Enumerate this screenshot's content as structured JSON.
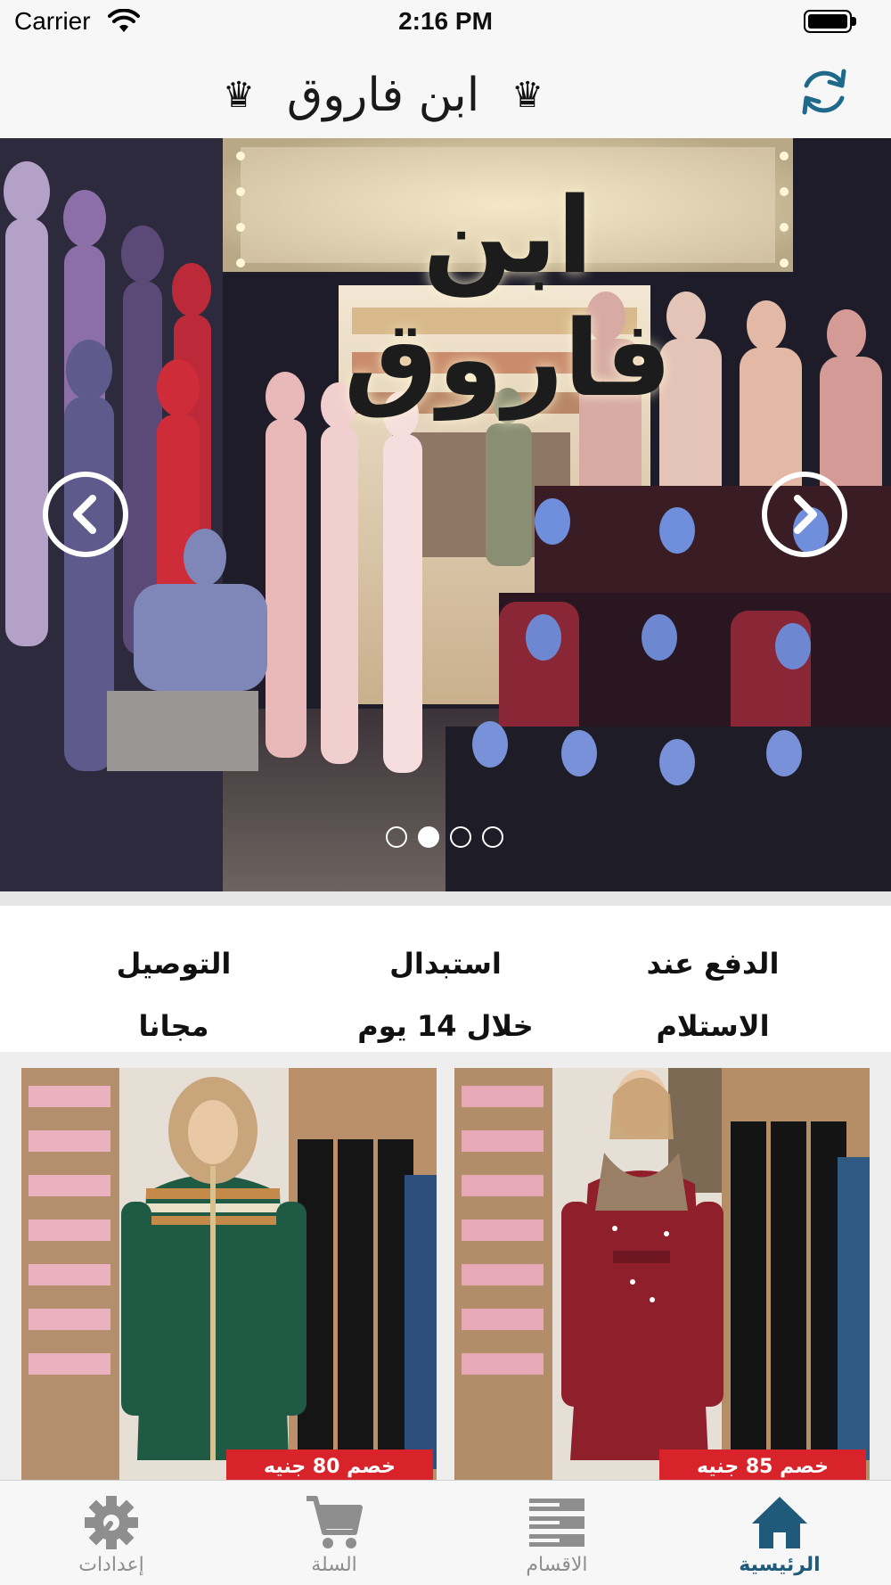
{
  "status_bar": {
    "carrier": "Carrier",
    "time": "2:16 PM"
  },
  "header": {
    "title": "ابن فاروق",
    "crown_glyph": "♛",
    "refresh_icon": "refresh-icon"
  },
  "hero": {
    "sign_text": "ابن فاروق",
    "slide_count": 4,
    "active_slide": 2,
    "prev_icon": "chevron-left-icon",
    "next_icon": "chevron-right-icon"
  },
  "features": [
    {
      "line1": "الدفع عند",
      "line2": "الاستلام"
    },
    {
      "line1": "استبدال",
      "line2": "خلال 14 يوم"
    },
    {
      "line1": "التوصيل",
      "line2": "مجانا"
    }
  ],
  "products": [
    {
      "discount": "خصم 85 جنيه",
      "dress_color": "#8e1f2b"
    },
    {
      "discount": "خصم 80 جنيه",
      "dress_color": "#1f5a45"
    }
  ],
  "tabs": [
    {
      "label": "إعدادات",
      "icon": "gear-icon",
      "active": false
    },
    {
      "label": "السلة",
      "icon": "cart-icon",
      "active": false
    },
    {
      "label": "الاقسام",
      "icon": "categories-icon",
      "active": false
    },
    {
      "label": "الرئيسية",
      "icon": "home-icon",
      "active": true
    }
  ],
  "colors": {
    "accent": "#1f5a7a",
    "badge": "#d9232a",
    "tab_inactive": "#8e8e8e"
  }
}
